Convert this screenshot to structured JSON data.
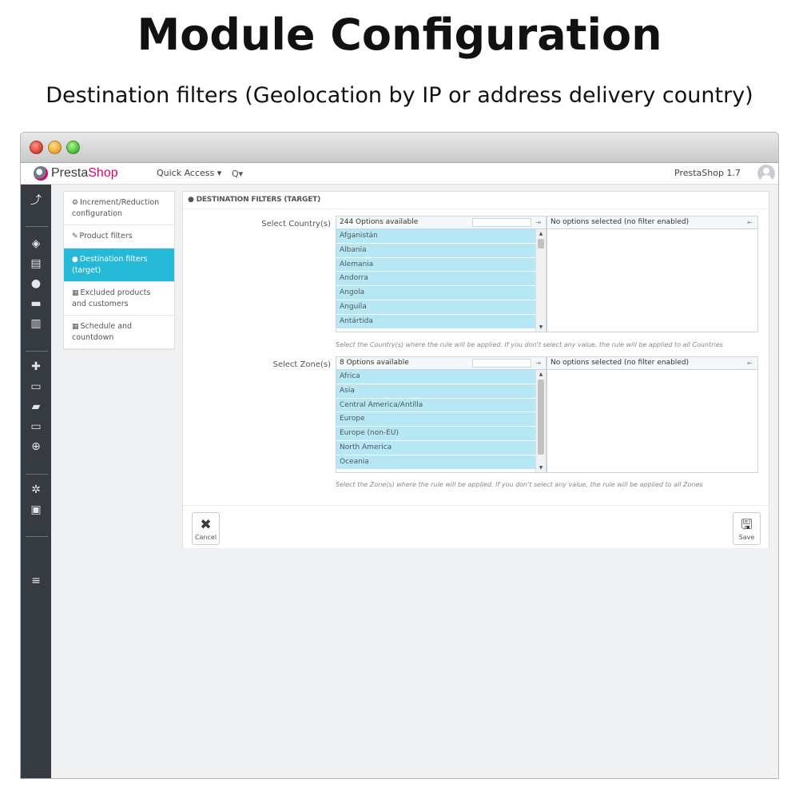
{
  "hero": {
    "title": "Module Configuration",
    "subtitle": "Destination filters (Geolocation by IP or address delivery country)"
  },
  "topbar": {
    "brand_prefix": "Presta",
    "brand_suffix": "Shop",
    "quick_access": "Quick Access ▾",
    "search_icon": "Q▾",
    "version": "PrestaShop 1.7"
  },
  "submenu": {
    "items": [
      {
        "label": "Increment/Reduction configuration",
        "icon": "gears-icon"
      },
      {
        "label": "Product filters",
        "icon": "edit-icon"
      },
      {
        "label": "Destination filters (target)",
        "icon": "globe-icon"
      },
      {
        "label": "Excluded products and customers",
        "icon": "calendar-icon"
      },
      {
        "label": "Schedule and countdown",
        "icon": "calendar-icon"
      }
    ]
  },
  "panel": {
    "heading": "DESTINATION FILTERS (TARGET)",
    "country": {
      "label": "Select Country(s)",
      "available": "244 Options available",
      "selected": "No options selected (no filter enabled)",
      "options": [
        "Afganistán",
        "Albania",
        "Alemania",
        "Andorra",
        "Angola",
        "Anguila",
        "Antártida"
      ],
      "help": "Select the Country(s) where the rule will be applied. If you don't select any value, the rule will be applied to all Countries"
    },
    "zone": {
      "label": "Select Zone(s)",
      "available": "8 Options available",
      "selected": "No options selected (no filter enabled)",
      "options": [
        "Africa",
        "Asia",
        "Central America/Antilla",
        "Europe",
        "Europe (non-EU)",
        "North America",
        "Oceania"
      ],
      "help": "Select the Zone(s) where the rule will be applied. If you don't select any value, the rule will be applied to all Zones"
    },
    "cancel_label": "Cancel",
    "save_label": "Save"
  }
}
